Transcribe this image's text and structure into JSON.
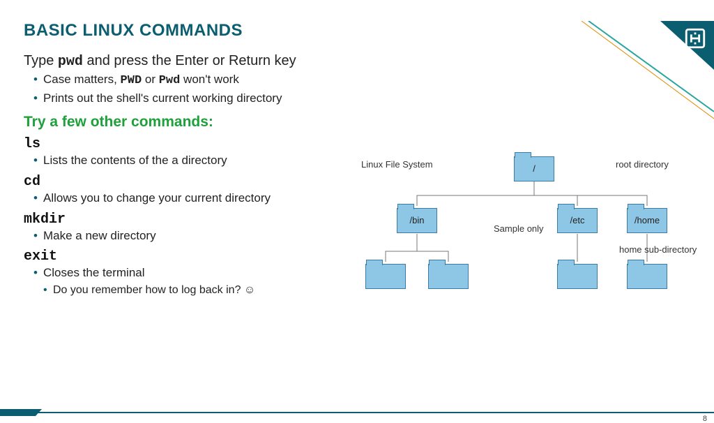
{
  "title": "BASIC LINUX COMMANDS",
  "intro": {
    "pre": "Type ",
    "cmd": "pwd",
    "post": " and press the Enter or Return key"
  },
  "intro_bullets": {
    "b1_pre": "Case matters, ",
    "b1_m1": "PWD",
    "b1_mid": " or ",
    "b1_m2": "Pwd",
    "b1_post": " won't work",
    "b2": "Prints out the shell's current working directory"
  },
  "try_header": "Try a few other commands:",
  "commands": {
    "ls": {
      "name": "ls",
      "desc": "Lists the contents of the a directory"
    },
    "cd": {
      "name": "cd",
      "desc": "Allows you to change your current directory"
    },
    "mkdir": {
      "name": "mkdir",
      "desc": "Make a new directory"
    },
    "exit": {
      "name": "exit",
      "desc": "Closes the terminal",
      "sub": "Do you remember how to log back in? ☺"
    }
  },
  "diagram": {
    "title": "Linux File System",
    "root_lbl": "root directory",
    "sample": "Sample only",
    "home_sub": "home sub-directory",
    "nodes": {
      "root": "/",
      "bin": "/bin",
      "etc": "/etc",
      "home": "/home"
    }
  },
  "page": "8"
}
